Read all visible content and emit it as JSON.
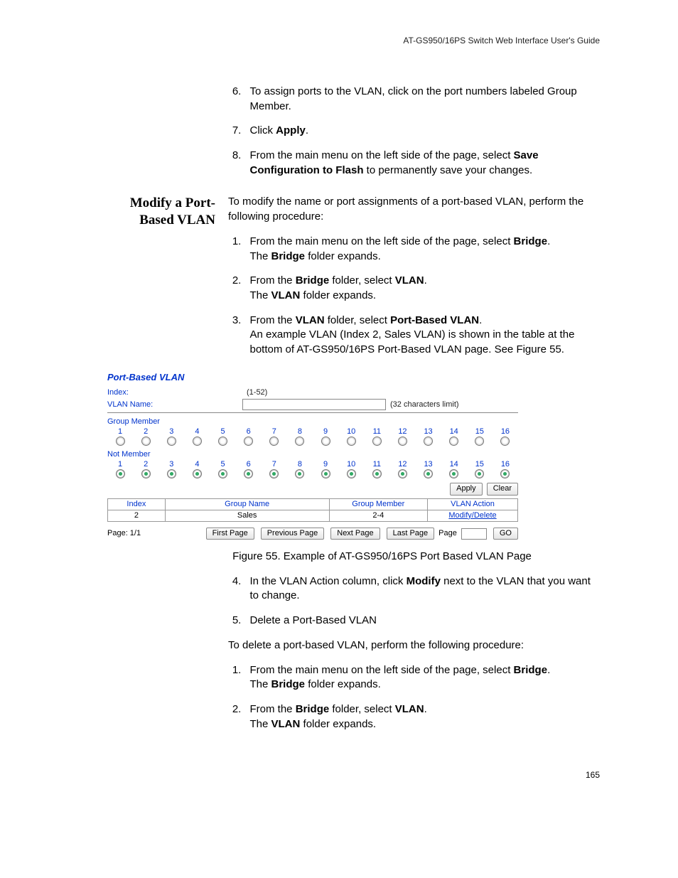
{
  "header": {
    "guide": "AT-GS950/16PS Switch Web Interface User's Guide"
  },
  "topSteps": {
    "s6": "To assign ports to the VLAN, click on the port numbers labeled Group Member.",
    "s7a": "Click ",
    "s7b": "Apply",
    "s7c": ".",
    "s8a": "From the main menu on the left side of the page, select ",
    "s8b": "Save Configuration to Flash",
    "s8c": " to permanently save your changes."
  },
  "section": {
    "heading": "Modify a Port-Based VLAN",
    "intro": "To modify the name or port assignments of a port-based VLAN, perform the following procedure:",
    "s1a": "From the main menu on the left side of the page, select ",
    "s1b": "Bridge",
    "s1c": ".",
    "s1d": "The ",
    "s1e": "Bridge",
    "s1f": " folder expands.",
    "s2a": "From the ",
    "s2b": "Bridge",
    "s2c": " folder, select ",
    "s2d": "VLAN",
    "s2e": ".",
    "s2f": "The ",
    "s2g": "VLAN",
    "s2h": " folder expands.",
    "s3a": "From the ",
    "s3b": "VLAN",
    "s3c": " folder, select ",
    "s3d": "Port-Based VLAN",
    "s3e": ".",
    "s3f": "An example VLAN (Index 2, Sales VLAN) is shown in the table at the bottom of AT-GS950/16PS Port-Based VLAN page. See Figure 55."
  },
  "panel": {
    "title": "Port-Based VLAN",
    "indexLabel": "Index:",
    "indexHint": "(1-52)",
    "nameLabel": "VLAN Name:",
    "nameHint": "(32 characters limit)",
    "groupMember": "Group Member",
    "notMember": "Not Member",
    "ports": [
      "1",
      "2",
      "3",
      "4",
      "5",
      "6",
      "7",
      "8",
      "9",
      "10",
      "11",
      "12",
      "13",
      "14",
      "15",
      "16"
    ],
    "applyBtn": "Apply",
    "clearBtn": "Clear",
    "table": {
      "hIndex": "Index",
      "hGroup": "Group Name",
      "hMember": "Group Member",
      "hAction": "VLAN Action",
      "rIndex": "2",
      "rGroup": "Sales",
      "rMember": "2-4",
      "rAction": "Modify/Delete"
    },
    "pager": {
      "label": "Page:  1/1",
      "first": "First Page",
      "prev": "Previous Page",
      "next": "Next Page",
      "last": "Last Page",
      "pageLbl": "Page",
      "go": "GO"
    }
  },
  "figCaption": "Figure 55. Example of AT-GS950/16PS Port Based VLAN Page",
  "afterFig": {
    "s4a": "In the VLAN Action column, click ",
    "s4b": "Modify",
    "s4c": " next to the VLAN that you want to change.",
    "s5": "Delete a Port-Based VLAN",
    "para": "To delete a port-based VLAN, perform the following procedure:",
    "d1a": "From the main menu on the left side of the page, select ",
    "d1b": "Bridge",
    "d1c": ".",
    "d1d": "The ",
    "d1e": "Bridge",
    "d1f": " folder expands.",
    "d2a": "From the ",
    "d2b": "Bridge",
    "d2c": " folder, select ",
    "d2d": "VLAN",
    "d2e": ".",
    "d2f": "The ",
    "d2g": "VLAN",
    "d2h": " folder expands."
  },
  "pageNum": "165"
}
